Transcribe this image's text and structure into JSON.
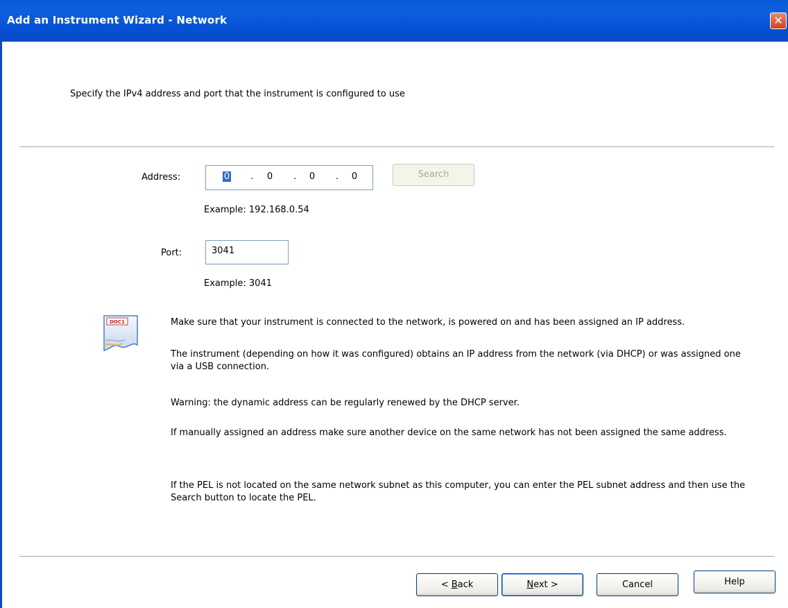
{
  "window": {
    "title": "Add an Instrument Wizard - Network",
    "close_label": "✕"
  },
  "intro": "Specify the IPv4 address and port that the instrument is configured to use",
  "address": {
    "label": "Address:",
    "octets": [
      "0",
      "0",
      "0",
      "0"
    ],
    "separator": ".",
    "example": "Example: 192.168.0.54",
    "search_label": "Search"
  },
  "port": {
    "label": "Port:",
    "value": "3041",
    "example": "Example: 3041"
  },
  "info": {
    "icon_text": "DOC1",
    "p1": "Make sure that your instrument is connected to the network, is powered on and has been assigned an IP address.",
    "p2": "The instrument (depending on how it was configured) obtains an IP address from the network (via DHCP) or was assigned one via a USB connection.",
    "p3": "Warning: the dynamic address can be regularly renewed by the DHCP server.",
    "p4": "If manually assigned an address make sure another device on the same network has not been assigned the same address.",
    "p5": "If the PEL is not located on the same network subnet as this computer, you can enter the PEL subnet address and then use the Search button to locate the PEL."
  },
  "footer": {
    "back_prefix": "< ",
    "back_key": "B",
    "back_rest": "ack",
    "next_key": "N",
    "next_rest": "ext >",
    "cancel_label": "Cancel",
    "help_label": "Help"
  }
}
